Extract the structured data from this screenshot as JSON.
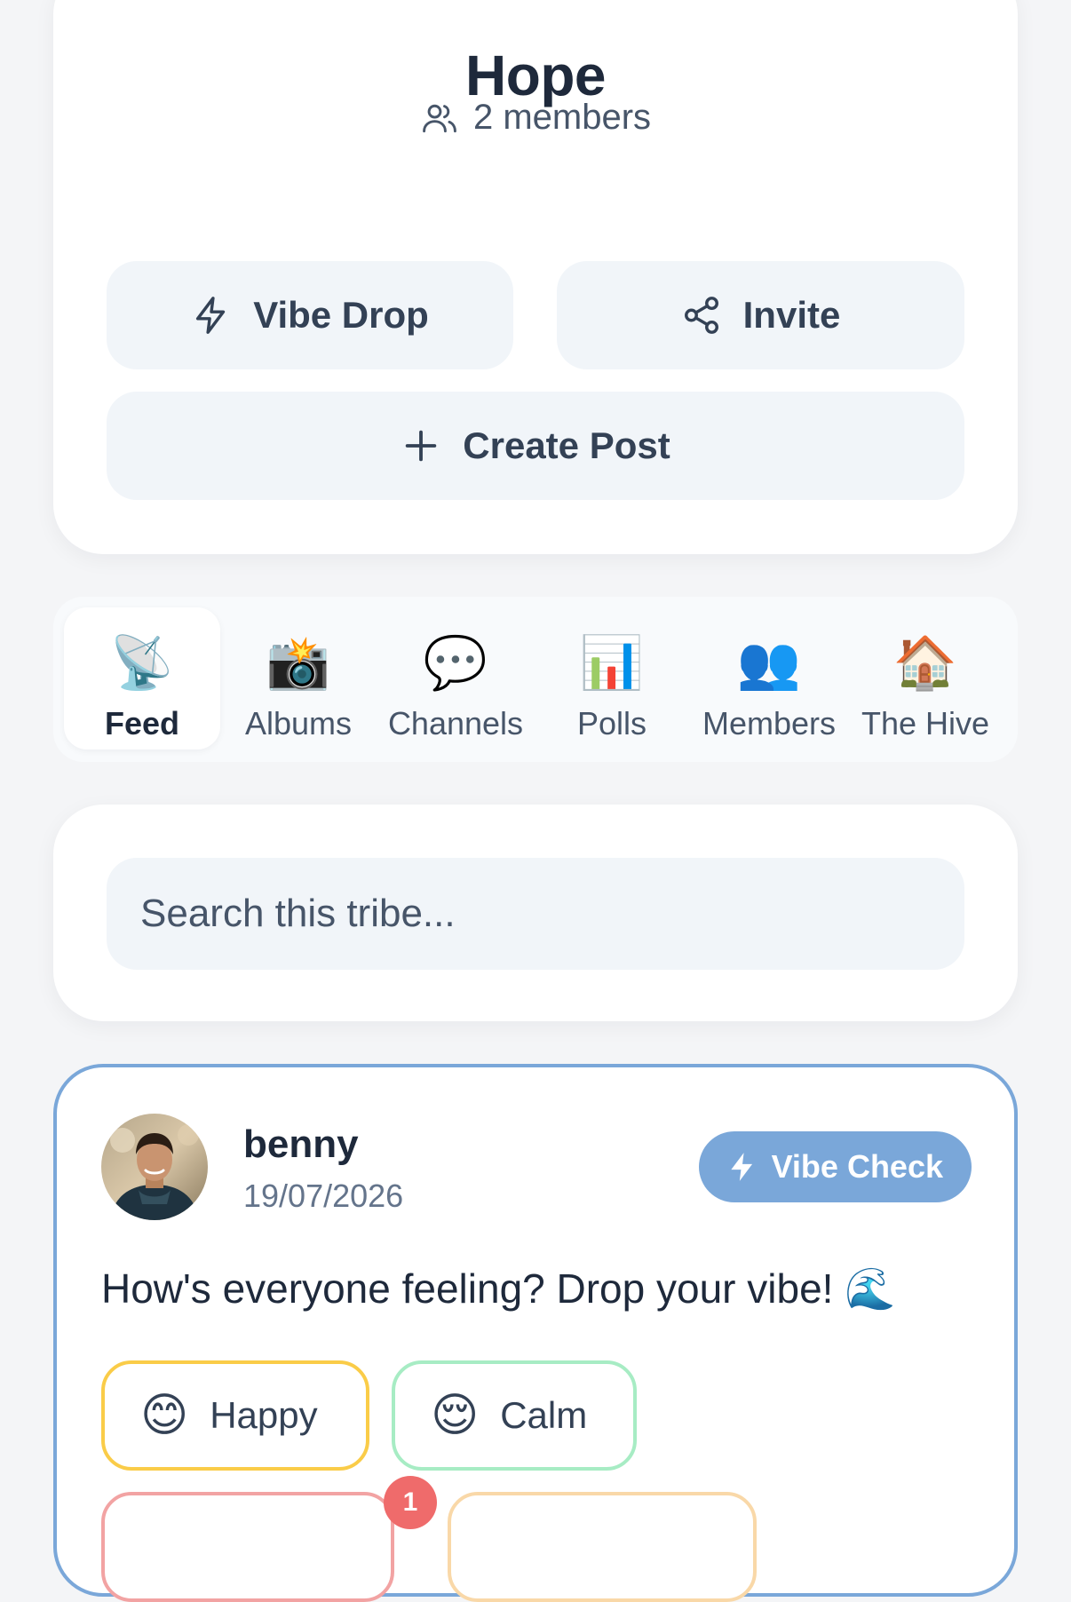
{
  "tribe": {
    "name": "Hope",
    "members_label": "2 members"
  },
  "actions": {
    "vibe_drop": "Vibe Drop",
    "invite": "Invite",
    "create_post": "Create Post"
  },
  "tabs": [
    {
      "emoji": "📡",
      "label": "Feed",
      "active": true
    },
    {
      "emoji": "📸",
      "label": "Albums"
    },
    {
      "emoji": "💬",
      "label": "Channels"
    },
    {
      "emoji": "📊",
      "label": "Polls"
    },
    {
      "emoji": "👥",
      "label": "Members"
    },
    {
      "emoji": "🏠",
      "label": "The Hive"
    }
  ],
  "search": {
    "placeholder": "Search this tribe..."
  },
  "post": {
    "author": "benny",
    "date": "19/07/2026",
    "badge": "Vibe Check",
    "text": "How's everyone feeling? Drop your vibe! 🌊",
    "moods": [
      {
        "emoji": "😊",
        "label": "Happy"
      },
      {
        "emoji": "😌",
        "label": "Calm"
      }
    ],
    "vote_count": "1"
  },
  "colors": {
    "accent": "#7aa7d9",
    "happy_border": "#facc48",
    "calm_border": "#a7ecc4",
    "badge_red": "#ef6b6b"
  }
}
